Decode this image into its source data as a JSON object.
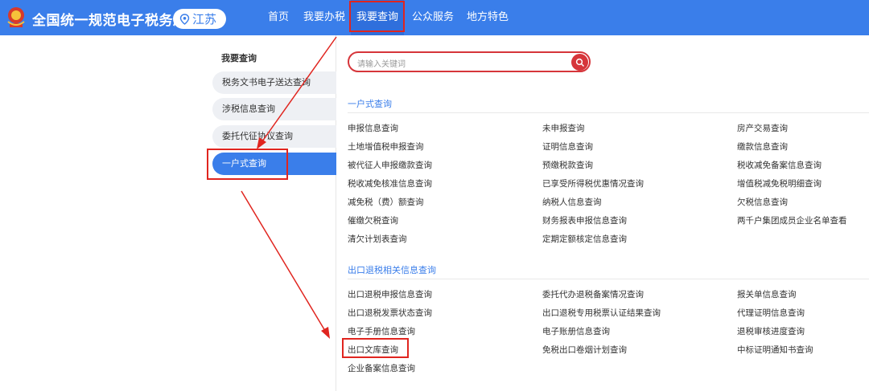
{
  "header": {
    "brand": "全国统一规范电子税务局",
    "region": "江苏",
    "nav": [
      "首页",
      "我要办税",
      "我要查询",
      "公众服务",
      "地方特色"
    ]
  },
  "sidebar": {
    "title": "我要查询",
    "items": [
      "税务文书电子送达查询",
      "涉税信息查询",
      "委托代征协议查询",
      "一户式查询"
    ]
  },
  "search": {
    "placeholder": "请输入关键词"
  },
  "sections": [
    {
      "title": "一户式查询",
      "links": [
        "申报信息查询",
        "未申报查询",
        "房产交易查询",
        "土地增值税申报查询",
        "证明信息查询",
        "缴款信息查询",
        "被代征人申报缴款查询",
        "预缴税款查询",
        "税收减免备案信息查询",
        "税收减免核准信息查询",
        "已享受所得税优惠情况查询",
        "增值税减免税明细查询",
        "减免税（费）额查询",
        "纳税人信息查询",
        "欠税信息查询",
        "催缴欠税查询",
        "财务报表申报信息查询",
        "两千户集团成员企业名单查看",
        "清欠计划表查询",
        "定期定额核定信息查询"
      ]
    },
    {
      "title": "出口退税相关信息查询",
      "links": [
        "出口退税申报信息查询",
        "委托代办退税备案情况查询",
        "报关单信息查询",
        "出口退税发票状态查询",
        "出口退税专用税票认证结果查询",
        "代理证明信息查询",
        "电子手册信息查询",
        "电子账册信息查询",
        "退税审核进度查询",
        "出口文库查询",
        "免税出口卷烟计划查询",
        "中标证明通知书查询",
        "企业备案信息查询"
      ]
    }
  ]
}
